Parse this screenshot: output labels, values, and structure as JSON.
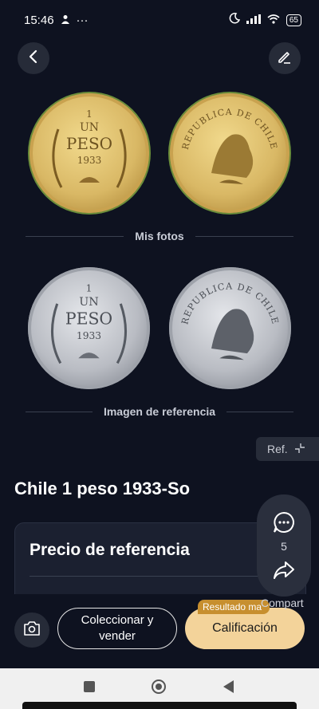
{
  "status_bar": {
    "time": "15:46",
    "extra": "···",
    "battery": "65"
  },
  "sections": {
    "my_photos_label": "Mis fotos",
    "reference_label": "Imagen de referencia"
  },
  "coin_text": {
    "obverse_value": "1",
    "obverse_un": "UN",
    "obverse_peso": "PESO",
    "obverse_year": "1933",
    "reverse_legend": "REPUBLICA DE CHILE"
  },
  "ref_tag": {
    "label": "Ref."
  },
  "coin_title": "Chile 1 peso 1933-So",
  "price_card": {
    "title": "Precio de referencia"
  },
  "float_panel": {
    "comment_count": "5",
    "share_label": "Compart"
  },
  "actions": {
    "collect_sell_label": "Coleccionar y vender",
    "grade_label": "Calificación",
    "result_badge": "Resultado ma"
  },
  "icons": [
    "person-icon",
    "moon-icon",
    "signal-icon",
    "wifi-icon",
    "back-icon",
    "edit-icon",
    "collapse-icon",
    "comment-icon",
    "share-icon",
    "camera-icon"
  ],
  "colors": {
    "background": "#0e1220",
    "grade_button": "#f3d39a",
    "badge": "#c78f2f"
  }
}
